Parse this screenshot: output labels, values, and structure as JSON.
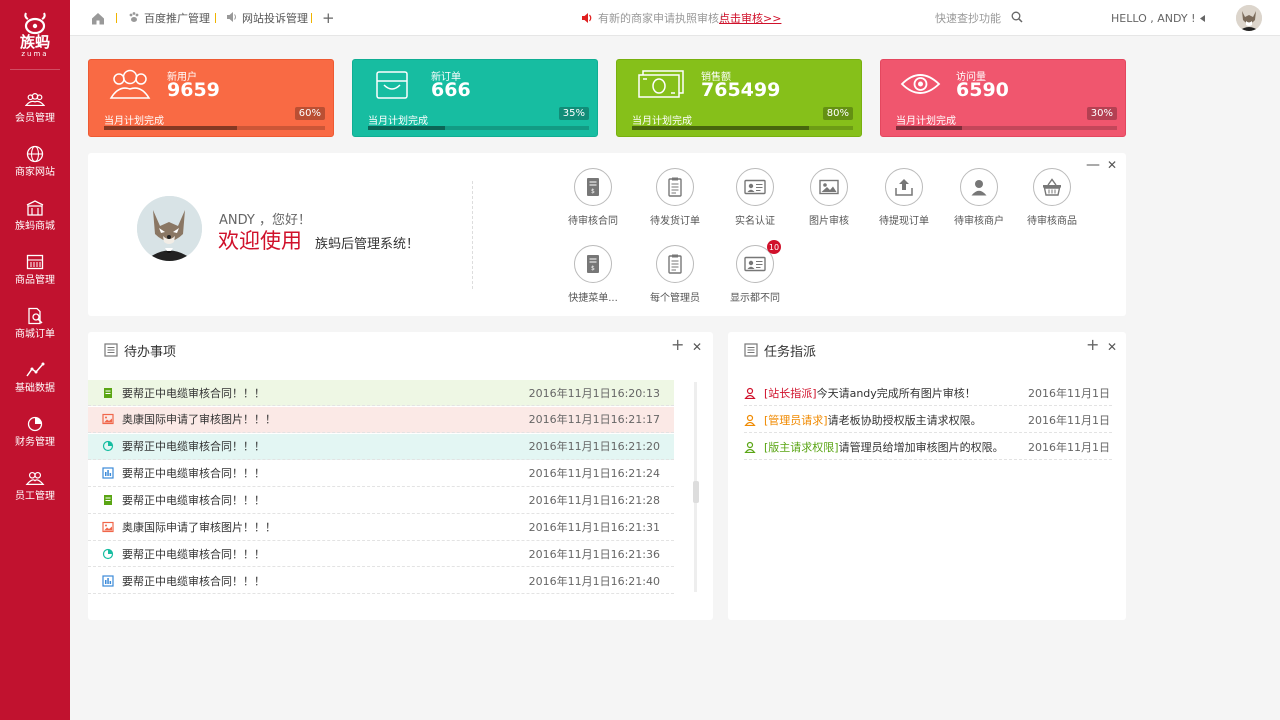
{
  "brand": {
    "name": "族蚂",
    "sub": "zuma"
  },
  "sidebar": {
    "items": [
      {
        "label": "会员管理",
        "icon": "members-icon"
      },
      {
        "label": "商家网站",
        "icon": "globe-icon"
      },
      {
        "label": "族蚂商城",
        "icon": "mall-icon"
      },
      {
        "label": "商品管理",
        "icon": "goods-icon"
      },
      {
        "label": "商城订单",
        "icon": "order-search-icon"
      },
      {
        "label": "基础数据",
        "icon": "line-chart-icon"
      },
      {
        "label": "财务管理",
        "icon": "pie-chart-icon"
      },
      {
        "label": "员工管理",
        "icon": "staff-icon"
      }
    ]
  },
  "topbar": {
    "tabs": [
      {
        "label": "百度推广管理",
        "icon": "paw-icon"
      },
      {
        "label": "网站投诉管理",
        "icon": "speaker-icon"
      }
    ],
    "add": "+",
    "notice": "有新的商家申请执照审核！",
    "notice_link": "点击审核>>",
    "search_placeholder": "快速查抄功能",
    "hello": "HELLO , ANDY !"
  },
  "stats": [
    {
      "label": "新用户",
      "value": "9659",
      "plan": "当月计划完成",
      "percent": "60%",
      "progress": 0.6,
      "color": "#f96a44",
      "icon": "users-icon"
    },
    {
      "label": "新订单",
      "value": "666",
      "plan": "当月计划完成",
      "percent": "35%",
      "progress": 0.35,
      "color": "#17bda1",
      "icon": "inbox-icon"
    },
    {
      "label": "销售额",
      "value": "765499",
      "plan": "当月计划完成",
      "percent": "80%",
      "progress": 0.8,
      "color": "#86c01a",
      "icon": "money-icon"
    },
    {
      "label": "访问量",
      "value": "6590",
      "plan": "当月计划完成",
      "percent": "30%",
      "progress": 0.3,
      "color": "#f0566e",
      "icon": "eye-icon"
    }
  ],
  "welcome": {
    "greet": "ANDY ，您好！",
    "big": "欢迎使用",
    "system": "族蚂后管理系统！",
    "minimize": "—",
    "close": "✕",
    "quick": [
      {
        "label": "待审核合同",
        "icon": "contract-icon"
      },
      {
        "label": "待发货订单",
        "icon": "clipboard-icon"
      },
      {
        "label": "实名认证",
        "icon": "id-card-icon"
      },
      {
        "label": "图片审核",
        "icon": "picture-icon"
      },
      {
        "label": "待提现订单",
        "icon": "withdraw-icon"
      },
      {
        "label": "待审核商户",
        "icon": "merchant-icon"
      },
      {
        "label": "待审核商品",
        "icon": "basket-icon"
      },
      {
        "label": "快捷菜单...",
        "icon": "contract-icon"
      },
      {
        "label": "每个管理员",
        "icon": "clipboard-icon"
      },
      {
        "label": "显示都不同",
        "icon": "id-card-icon",
        "badge": "10"
      }
    ]
  },
  "todo": {
    "title": "待办事项",
    "add": "+",
    "close": "✕",
    "rows": [
      {
        "text": "要帮正中电缆审核合同！！！",
        "time": "2016年11月1日16:20:13",
        "icon": "green-doc-icon",
        "bg": "#eef7e4"
      },
      {
        "text": "奥康国际申请了审核图片！！！",
        "time": "2016年11月1日16:21:17",
        "icon": "orange-image-icon",
        "bg": "#fbe9e6"
      },
      {
        "text": "要帮正中电缆审核合同！！！",
        "time": "2016年11月1日16:21:20",
        "icon": "teal-pie-icon",
        "bg": "#e3f6f3"
      },
      {
        "text": "要帮正中电缆审核合同！！！",
        "time": "2016年11月1日16:21:24",
        "icon": "blue-chart-icon",
        "bg": "#ffffff"
      },
      {
        "text": "要帮正中电缆审核合同！！！",
        "time": "2016年11月1日16:21:28",
        "icon": "green-doc-icon",
        "bg": "#ffffff"
      },
      {
        "text": "奥康国际申请了审核图片！！！",
        "time": "2016年11月1日16:21:31",
        "icon": "orange-image-icon",
        "bg": "#ffffff"
      },
      {
        "text": "要帮正中电缆审核合同！！！",
        "time": "2016年11月1日16:21:36",
        "icon": "teal-pie-icon",
        "bg": "#ffffff"
      },
      {
        "text": "要帮正中电缆审核合同！！！",
        "time": "2016年11月1日16:21:40",
        "icon": "blue-chart-icon",
        "bg": "#ffffff"
      }
    ]
  },
  "tasks": {
    "title": "任务指派",
    "add": "+",
    "close": "✕",
    "rows": [
      {
        "tag": "[站长指派]",
        "text": "今天请andy完成所有图片审核！",
        "time": "2016年11月1日",
        "color": "#d0112b"
      },
      {
        "tag": "[管理员请求]",
        "text": "请老板协助授权版主请求权限。",
        "time": "2016年11月1日",
        "color": "#f08a00"
      },
      {
        "tag": "[版主请求权限]",
        "text": "请管理员给增加审核图片的权限。",
        "time": "2016年11月1日",
        "color": "#5aa514"
      }
    ]
  }
}
